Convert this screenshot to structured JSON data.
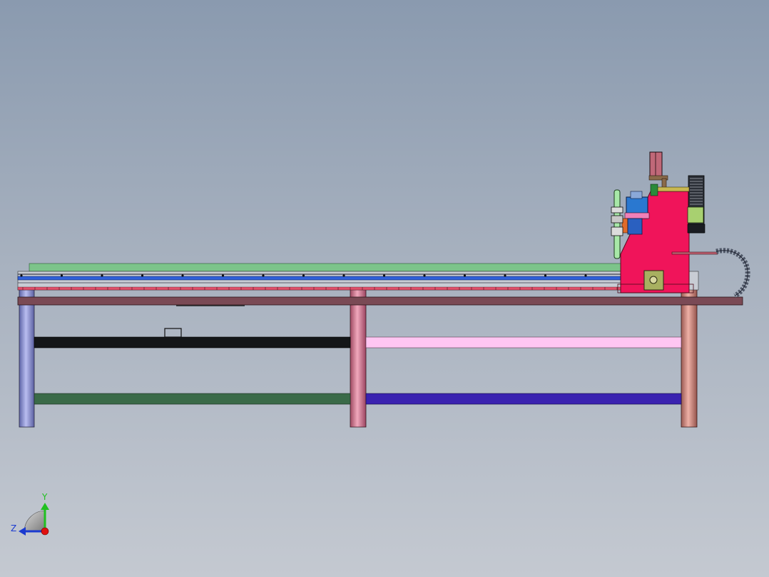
{
  "view": {
    "axes": {
      "y_label": "Y",
      "z_label": "Z"
    }
  },
  "model": {
    "parts": [
      "frame-leg-left",
      "frame-leg-middle",
      "frame-leg-right",
      "table-top",
      "upper-crossbar-left",
      "upper-crossbar-right",
      "lower-crossbar-left",
      "lower-crossbar-right",
      "linear-rail",
      "gantry-carriage",
      "cable-drag-chain",
      "stepper-motor",
      "spindle-motor",
      "tool-holder"
    ],
    "colors": {
      "leg_left": "#8a8fd0",
      "leg_middle": "#d07a92",
      "leg_right": "#c9857c",
      "table_top": "#7a4a55",
      "crossbar_upper_left": "#141618",
      "crossbar_upper_right": "#ffc6f2",
      "crossbar_lower_left": "#3a6a48",
      "crossbar_lower_right": "#3a22b0",
      "rail_top": "#7cc48a",
      "rail_blue": "#3060d8",
      "rail_red": "#e0506a",
      "gantry": "#f0145a",
      "motor_blue": "#2a78d0",
      "tool_green": "#a8e8a8",
      "motor_olive": "#a8b060",
      "chain": "#505868"
    }
  }
}
